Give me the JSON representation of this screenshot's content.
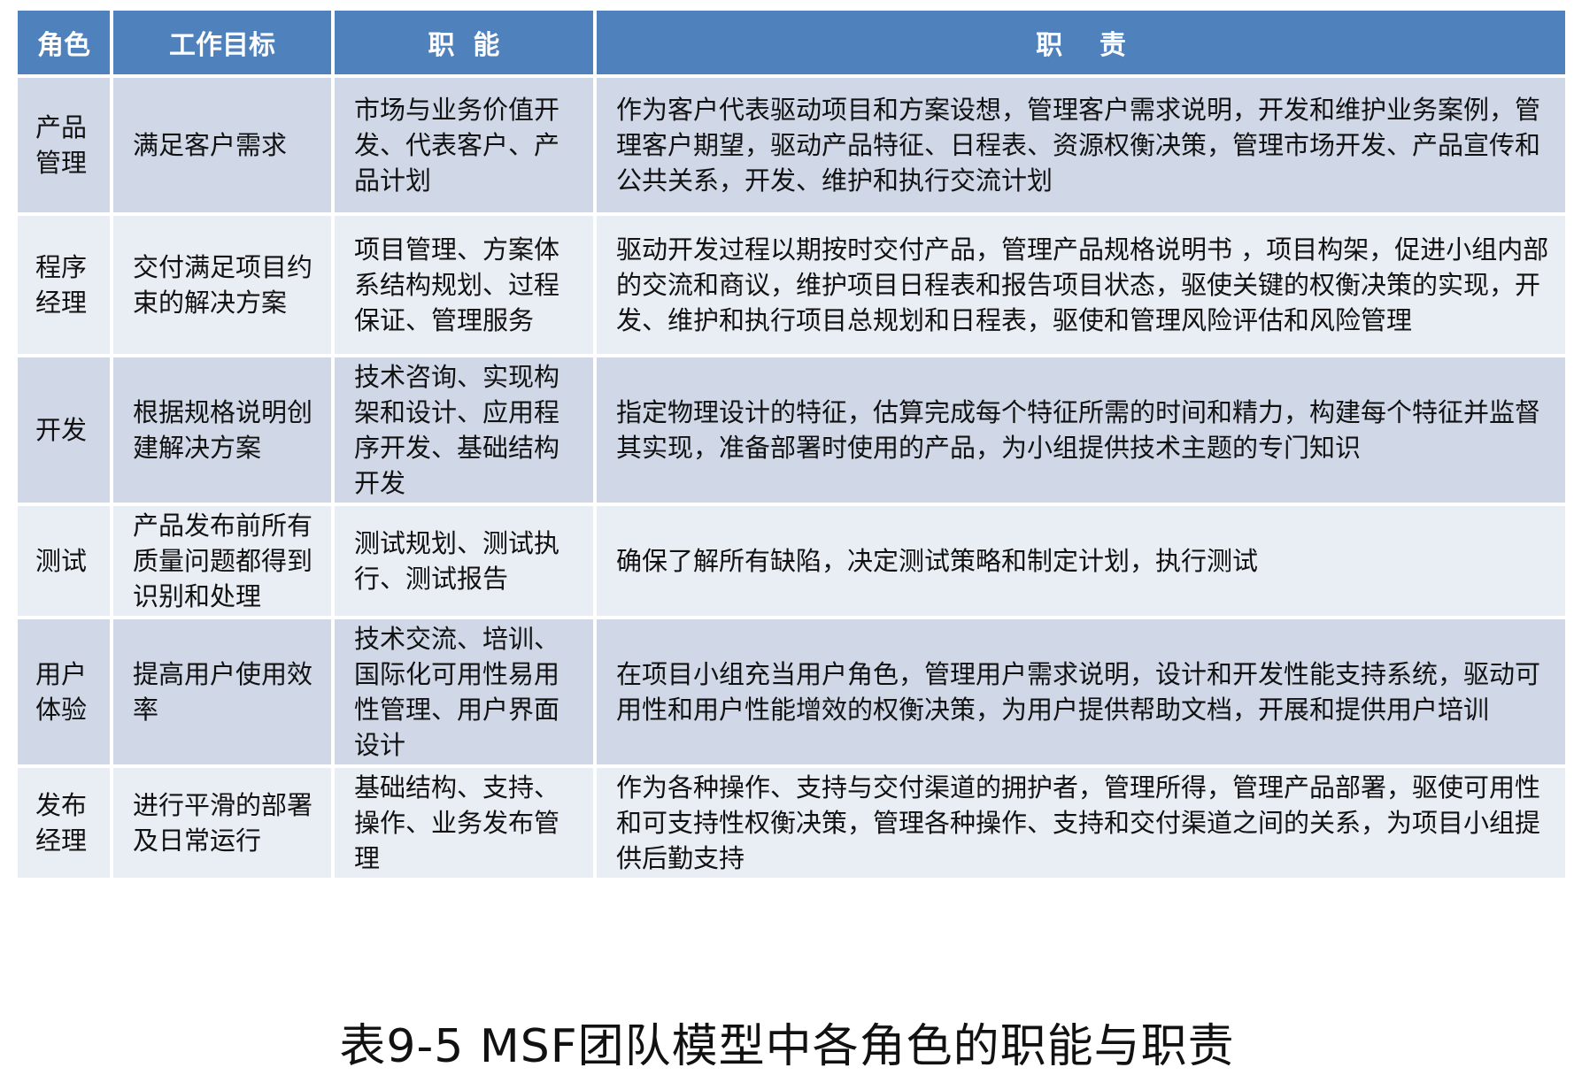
{
  "table": {
    "headers": [
      "角色",
      "工作目标",
      "职  能",
      "职    责"
    ],
    "rows": [
      {
        "role": "产品\n管理",
        "goal": "满足客户需求",
        "function": "市场与业务价值开发、代表客户、产品计划",
        "duty": "作为客户代表驱动项目和方案设想，管理客户需求说明，开发和维护业务案例，管理客户期望，驱动产品特征、日程表、资源权衡决策，管理市场开发、产品宣传和公共关系，开发、维护和执行交流计划"
      },
      {
        "role": "程序\n经理",
        "goal": "交付满足项目约束的解决方案",
        "function": "项目管理、方案体系结构规划、过程保证、管理服务",
        "duty": "驱动开发过程以期按时交付产品，管理产品规格说明书 ，项目构架，促进小组内部的交流和商议，维护项目日程表和报告项目状态，驱使关键的权衡决策的实现，开发、维护和执行项目总规划和日程表，驱使和管理风险评估和风险管理"
      },
      {
        "role": "开发",
        "goal": "根据规格说明创建解决方案",
        "function": "技术咨询、实现构架和设计、应用程序开发、基础结构开发",
        "duty": "指定物理设计的特征，估算完成每个特征所需的时间和精力，构建每个特征并监督其实现，准备部署时使用的产品，为小组提供技术主题的专门知识"
      },
      {
        "role": "测试",
        "goal": "产品发布前所有质量问题都得到识别和处理",
        "function": "测试规划、测试执行、测试报告",
        "duty": "确保了解所有缺陷，决定测试策略和制定计划，执行测试"
      },
      {
        "role": "用户\n体验",
        "goal": "提高用户使用效率",
        "function": "技术交流、培训、国际化可用性易用性管理、用户界面设计",
        "duty": "在项目小组充当用户角色，管理用户需求说明，设计和开发性能支持系统，驱动可用性和用户性能增效的权衡决策，为用户提供帮助文档，开展和提供用户培训"
      },
      {
        "role": "发布\n经理",
        "goal": "进行平滑的部署及日常运行",
        "function": "基础结构、支持、操作、业务发布管理",
        "duty": "作为各种操作、支持与交付渠道的拥护者，管理所得，管理产品部署，驱使可用性和可支持性权衡决策，管理各种操作、支持和交付渠道之间的关系，为项目小组提供后勤支持"
      }
    ]
  },
  "caption": "表9-5 MSF团队模型中各角色的职能与职责",
  "colors": {
    "header_bg": "#4f81bd",
    "row_odd_bg": "#d0d8e8",
    "row_even_bg": "#e9edf4"
  }
}
